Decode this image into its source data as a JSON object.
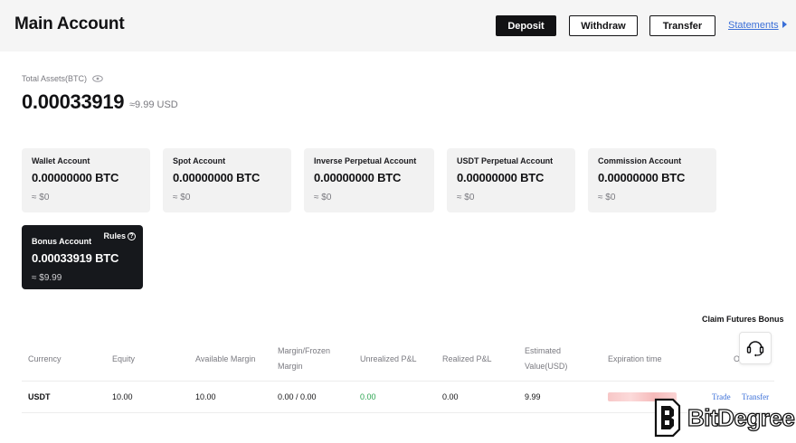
{
  "header": {
    "title": "Main Account",
    "deposit_label": "Deposit",
    "withdraw_label": "Withdraw",
    "transfer_label": "Transfer",
    "statements_label": "Statements"
  },
  "total": {
    "label": "Total Assets(BTC)",
    "value": "0.00033919",
    "usd": "≈9.99 USD"
  },
  "accounts": [
    {
      "name": "Wallet Account",
      "value": "0.00000000 BTC",
      "usd": "≈ $0"
    },
    {
      "name": "Spot Account",
      "value": "0.00000000 BTC",
      "usd": "≈ $0"
    },
    {
      "name": "Inverse Perpetual Account",
      "value": "0.00000000 BTC",
      "usd": "≈ $0"
    },
    {
      "name": "USDT Perpetual Account",
      "value": "0.00000000 BTC",
      "usd": "≈ $0"
    },
    {
      "name": "Commission Account",
      "value": "0.00000000 BTC",
      "usd": "≈ $0"
    }
  ],
  "bonus": {
    "name": "Bonus Account",
    "rules_label": "Rules",
    "value": "0.00033919 BTC",
    "usd": "≈ $9.99"
  },
  "claim_label": "Claim Futures Bonus",
  "table": {
    "headers": {
      "currency": "Currency",
      "equity": "Equity",
      "available_margin": "Available Margin",
      "margin_frozen_1": "Margin/Frozen",
      "margin_frozen_2": "Margin",
      "unrealized": "Unrealized P&L",
      "realized": "Realized P&L",
      "estimated_1": "Estimated",
      "estimated_2": "Value(USD)",
      "expiration": "Expiration time",
      "operation": "O"
    },
    "row": {
      "currency": "USDT",
      "equity": "10.00",
      "available_margin": "10.00",
      "margin_frozen": "0.00 / 0.00",
      "unrealized": "0.00",
      "realized": "0.00",
      "estimated": "9.99",
      "trade_label": "Trade",
      "transfer_label": "Transfer"
    }
  },
  "watermark": "BitDegree",
  "colors": {
    "accent_link": "#3a6fd8",
    "positive": "#2aa44f",
    "dark_card": "#16181c"
  }
}
